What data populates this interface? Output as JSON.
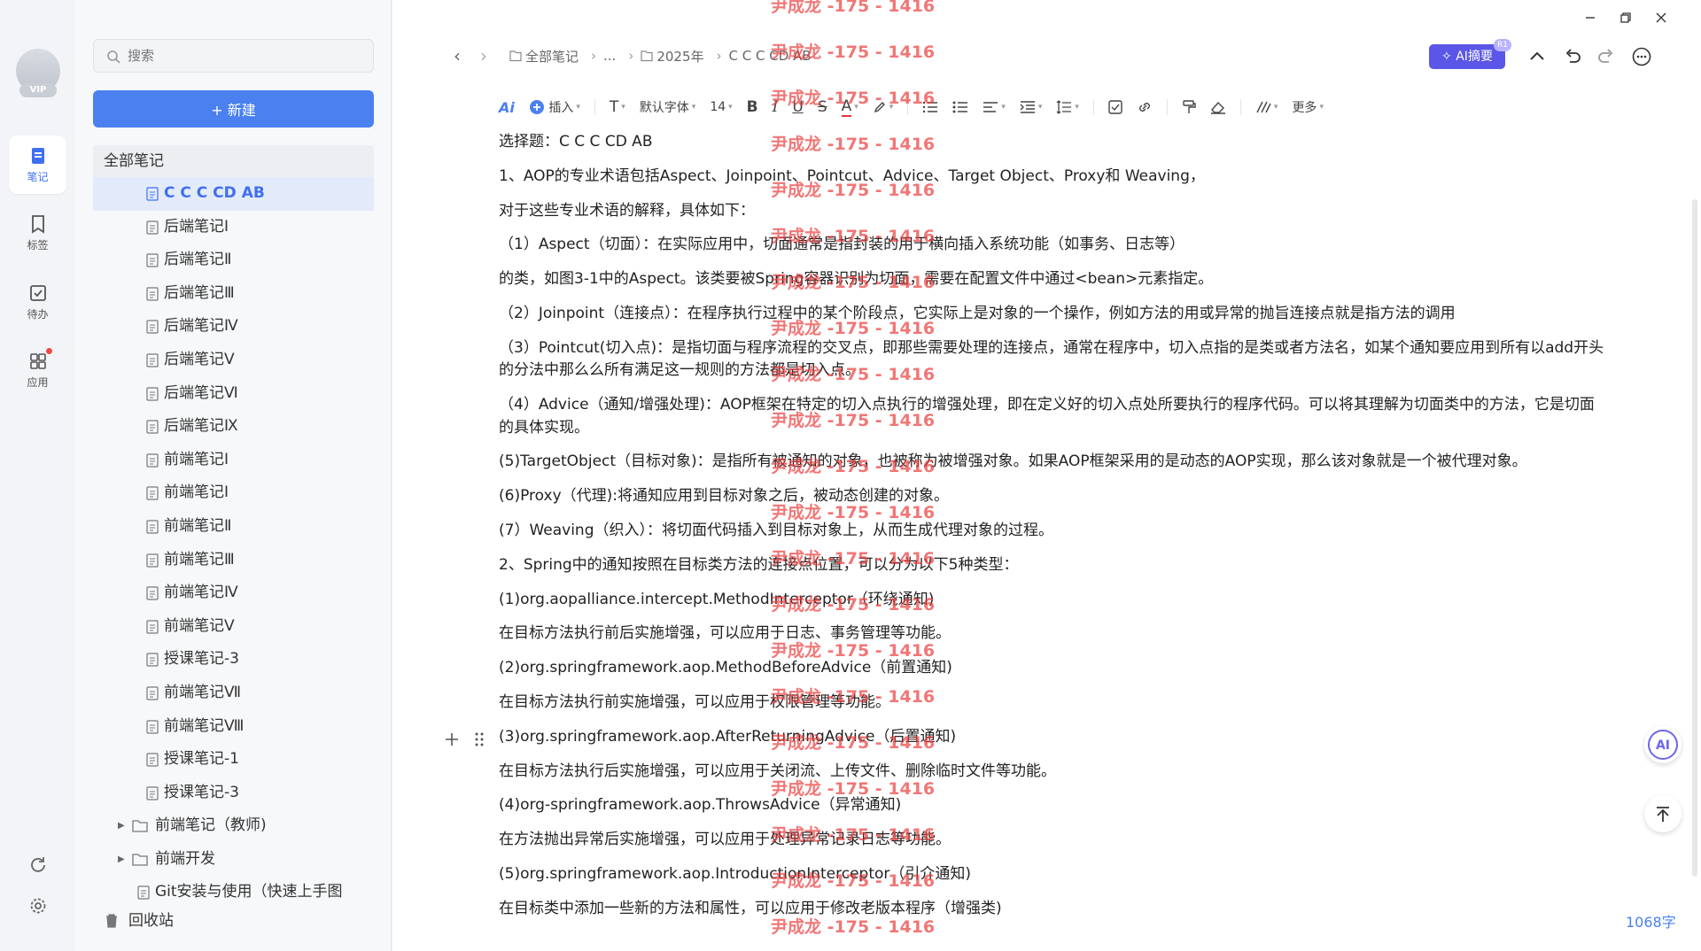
{
  "rail": {
    "items": [
      {
        "label": "笔记",
        "icon": "note-icon",
        "active": true
      },
      {
        "label": "标签",
        "icon": "bookmark-icon",
        "active": false
      },
      {
        "label": "待办",
        "icon": "checkbox-icon",
        "active": false
      },
      {
        "label": "应用",
        "icon": "apps-icon",
        "active": false
      }
    ],
    "vip_badge": "VIP"
  },
  "sidebar": {
    "search_placeholder": "搜索",
    "new_button": "+ 新建",
    "root_label": "全部笔记",
    "notes": [
      {
        "title": "C C C CD AB",
        "active": true
      },
      {
        "title": "后端笔记Ⅰ"
      },
      {
        "title": "后端笔记Ⅱ"
      },
      {
        "title": "后端笔记Ⅲ"
      },
      {
        "title": "后端笔记Ⅳ"
      },
      {
        "title": "后端笔记Ⅴ"
      },
      {
        "title": "后端笔记Ⅵ"
      },
      {
        "title": "后端笔记Ⅸ"
      },
      {
        "title": "前端笔记Ⅰ"
      },
      {
        "title": "前端笔记Ⅰ"
      },
      {
        "title": "前端笔记Ⅱ"
      },
      {
        "title": "前端笔记Ⅲ"
      },
      {
        "title": "前端笔记Ⅳ"
      },
      {
        "title": "前端笔记Ⅴ"
      },
      {
        "title": "授课笔记-3"
      },
      {
        "title": "前端笔记Ⅶ"
      },
      {
        "title": "前端笔记Ⅷ"
      },
      {
        "title": "授课笔记-1"
      },
      {
        "title": "授课笔记-3"
      }
    ],
    "folders": [
      {
        "title": "前端笔记（教师)"
      },
      {
        "title": "前端开发"
      }
    ],
    "partial_item": "Git安装与使用（快速上手图",
    "trash_label": "回收站"
  },
  "header": {
    "breadcrumb": [
      "全部笔记",
      "...",
      "2025年",
      "C C C CD AB"
    ],
    "ai_summary_label": "AI摘要",
    "r1_tag": "R1"
  },
  "toolbar": {
    "ai_label": "Ai",
    "insert_label": "插入",
    "text_style_label": "T",
    "font_label": "默认字体",
    "font_size": "14",
    "more_label": "更多"
  },
  "content": {
    "paragraphs": [
      "选择题：C C C CD AB",
      "1、AOP的专业术语包括Aspect、Joinpoint、Pointcut、Advice、Target Object、Proxy和 Weaving，",
      "对于这些专业术语的解释，具体如下：",
      "（1）Aspect（切面）：在实际应用中，切面通常是指封装的用于横向插入系统功能（如事务、日志等）",
      "的类，如图3-1中的Aspect。该类要被Spring容器识别为切面，需要在配置文件中通过<bean>元素指定。",
      "（2）Joinpoint（连接点）：在程序执行过程中的某个阶段点，它实际上是对象的一个操作，例如方法的用或异常的抛旨连接点就是指方法的调用",
      "（3）Pointcut(切入点)：是指切面与程序流程的交叉点，即那些需要处理的连接点，通常在程序中，切入点指的是类或者方法名，如某个通知要应用到所有以add开头的分法中那么么所有满足这一规则的方法都是切入点。",
      "（4）Advice（通知/增强处理)：AOP框架在特定的切入点执行的增强处理，即在定义好的切入点处所要执行的程序代码。可以将其理解为切面类中的方法，它是切面的具体实现。",
      "(5)TargetObject（目标对象)：是指所有被通知的对象，也被称为被增强对象。如果AOP框架采用的是动态的AOP实现，那么该对象就是一个被代理对象。",
      "(6)Proxy（代理):将通知应用到目标对象之后，被动态创建的对象。",
      "(7）Weaving（织入）：将切面代码插入到目标对象上，从而生成代理对象的过程。",
      "2、Spring中的通知按照在目标类方法的连接点位置，可以分为以下5种类型：",
      "(1)org.aopalliance.intercept.MethodInterceptor（环绕通知)",
      "在目标方法执行前后实施增强，可以应用于日志、事务管理等功能。",
      "(2)org.springframework.aop.MethodBeforeAdvice（前置通知)",
      "在目标方法执行前实施增强，可以应用于权限管理等功能。",
      "(3)org.springframework.aop.AfterReturningAdvice（后置通知)",
      "在目标方法执行后实施增强，可以应用于关闭流、上传文件、删除临时文件等功能。",
      "(4)org-springframework.aop.ThrowsAdvice（异常通知)",
      "在方法抛出异常后实施增强，可以应用于处理异常记录日志等功能。",
      "(5)org.springframework.aop.IntroductionInterceptor（引介通知)",
      "在目标类中添加一些新的方法和属性，可以应用于修改老版本程序（增强类)"
    ],
    "word_count": "1068字"
  },
  "watermark": {
    "text": "尹成龙 -175 - 1416"
  },
  "colors": {
    "accent": "#4a80f0",
    "ai_purple": "#5b56e8",
    "watermark": "#eb3c3c"
  }
}
